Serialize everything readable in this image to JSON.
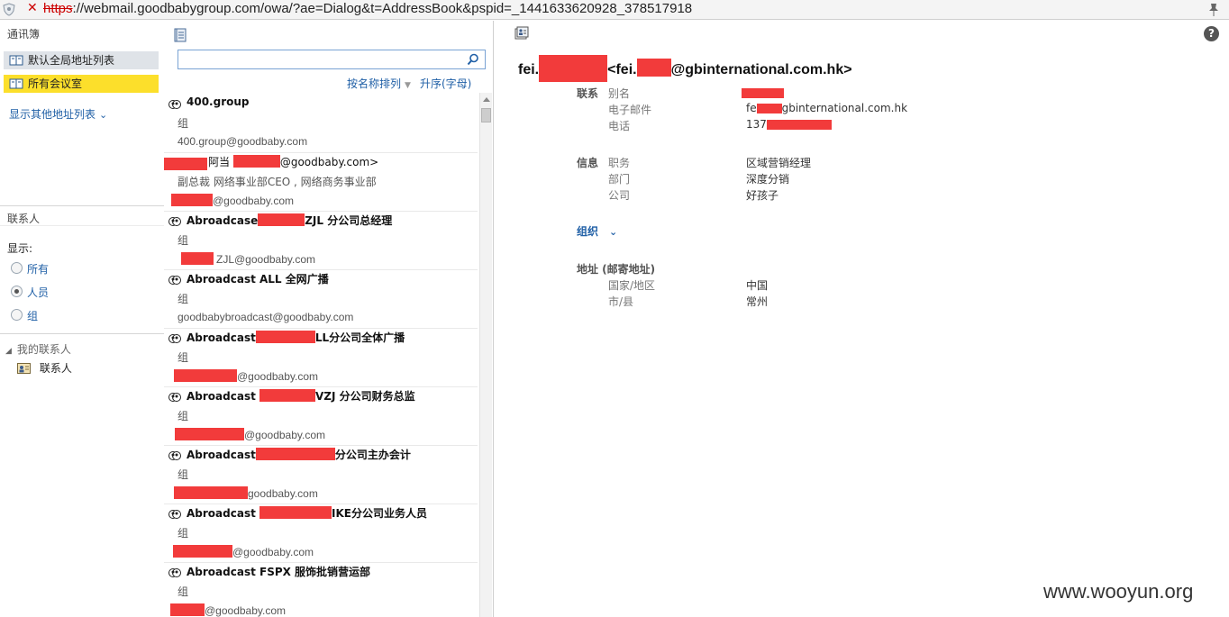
{
  "browser": {
    "url_proto": "https",
    "url_rest": "://webmail.goodbabygroup.com/owa/?ae=Dialog&t=AddressBook&pspid=_1441633620928_378517918"
  },
  "left": {
    "header": "通讯簿",
    "lists": [
      "默认全局地址列表",
      "所有会议室"
    ],
    "more_link": "显示其他地址列表",
    "contacts_header": "联系人",
    "show_label": "显示:",
    "filters": [
      "所有",
      "人员",
      "组"
    ],
    "selected_filter": "人员",
    "my_contacts": "我的联系人",
    "contacts_folder": "联系人"
  },
  "middle": {
    "search_placeholder": "",
    "sort_by": "按名称排列",
    "sort_order": "升序(字母)",
    "entries": [
      {
        "name": "400.group",
        "sub": "组",
        "mail": "400.group@goodbaby.com"
      },
      {
        "name": "阿当",
        "name_suffix": "@goodbaby.com>",
        "sub": "副总裁 网络事业部CEO , 网络商务事业部",
        "mail": "@goodbaby.com"
      },
      {
        "name": "Abroadcase",
        "name_suffix": "ZJL 分公司总经理",
        "sub": "组",
        "mail": "ZJL@goodbaby.com"
      },
      {
        "name": "Abroadcast ALL 全网广播",
        "sub": "组",
        "mail": "goodbabybroadcast@goodbaby.com"
      },
      {
        "name": "Abroadcast",
        "name_suffix": "LL分公司全体广播",
        "sub": "组",
        "mail": "@goodbaby.com"
      },
      {
        "name": "Abroadcast",
        "name_suffix": "VZJ 分公司财务总监",
        "sub": "组",
        "mail": "@goodbaby.com"
      },
      {
        "name": "Abroadcast",
        "name_suffix": "分公司主办会计",
        "sub": "组",
        "mail": "goodbaby.com"
      },
      {
        "name": "Abroadcast",
        "name_suffix": "IKE分公司业务人员",
        "sub": "组",
        "mail": "@goodbaby.com"
      },
      {
        "name": "Abroadcast FSPX 服饰批销营运部",
        "sub": "组",
        "mail": "@goodbaby.com"
      }
    ]
  },
  "detail": {
    "title_prefix": "fei.",
    "title_mid": "<fei.",
    "title_suffix": "@gbinternational.com.hk>",
    "sections": {
      "contact": "联系",
      "info": "信息",
      "org": "组织",
      "address": "地址 (邮寄地址)"
    },
    "labels": {
      "alias": "别名",
      "email": "电子邮件",
      "phone": "电话",
      "job": "职务",
      "dept": "部门",
      "company": "公司",
      "country": "国家/地区",
      "city": "市/县"
    },
    "values": {
      "email_a": "fe",
      "email_b": "gbinternational.com.hk",
      "phone": "137",
      "job": "区域营销经理",
      "dept": "深度分销",
      "company": "好孩子",
      "country": "中国",
      "city": "常州"
    }
  },
  "watermark": "www.wooyun.org",
  "colors": {
    "selected_list": "#fcdf2b",
    "link": "#1f5fa6",
    "redaction": "#f23b3b"
  }
}
